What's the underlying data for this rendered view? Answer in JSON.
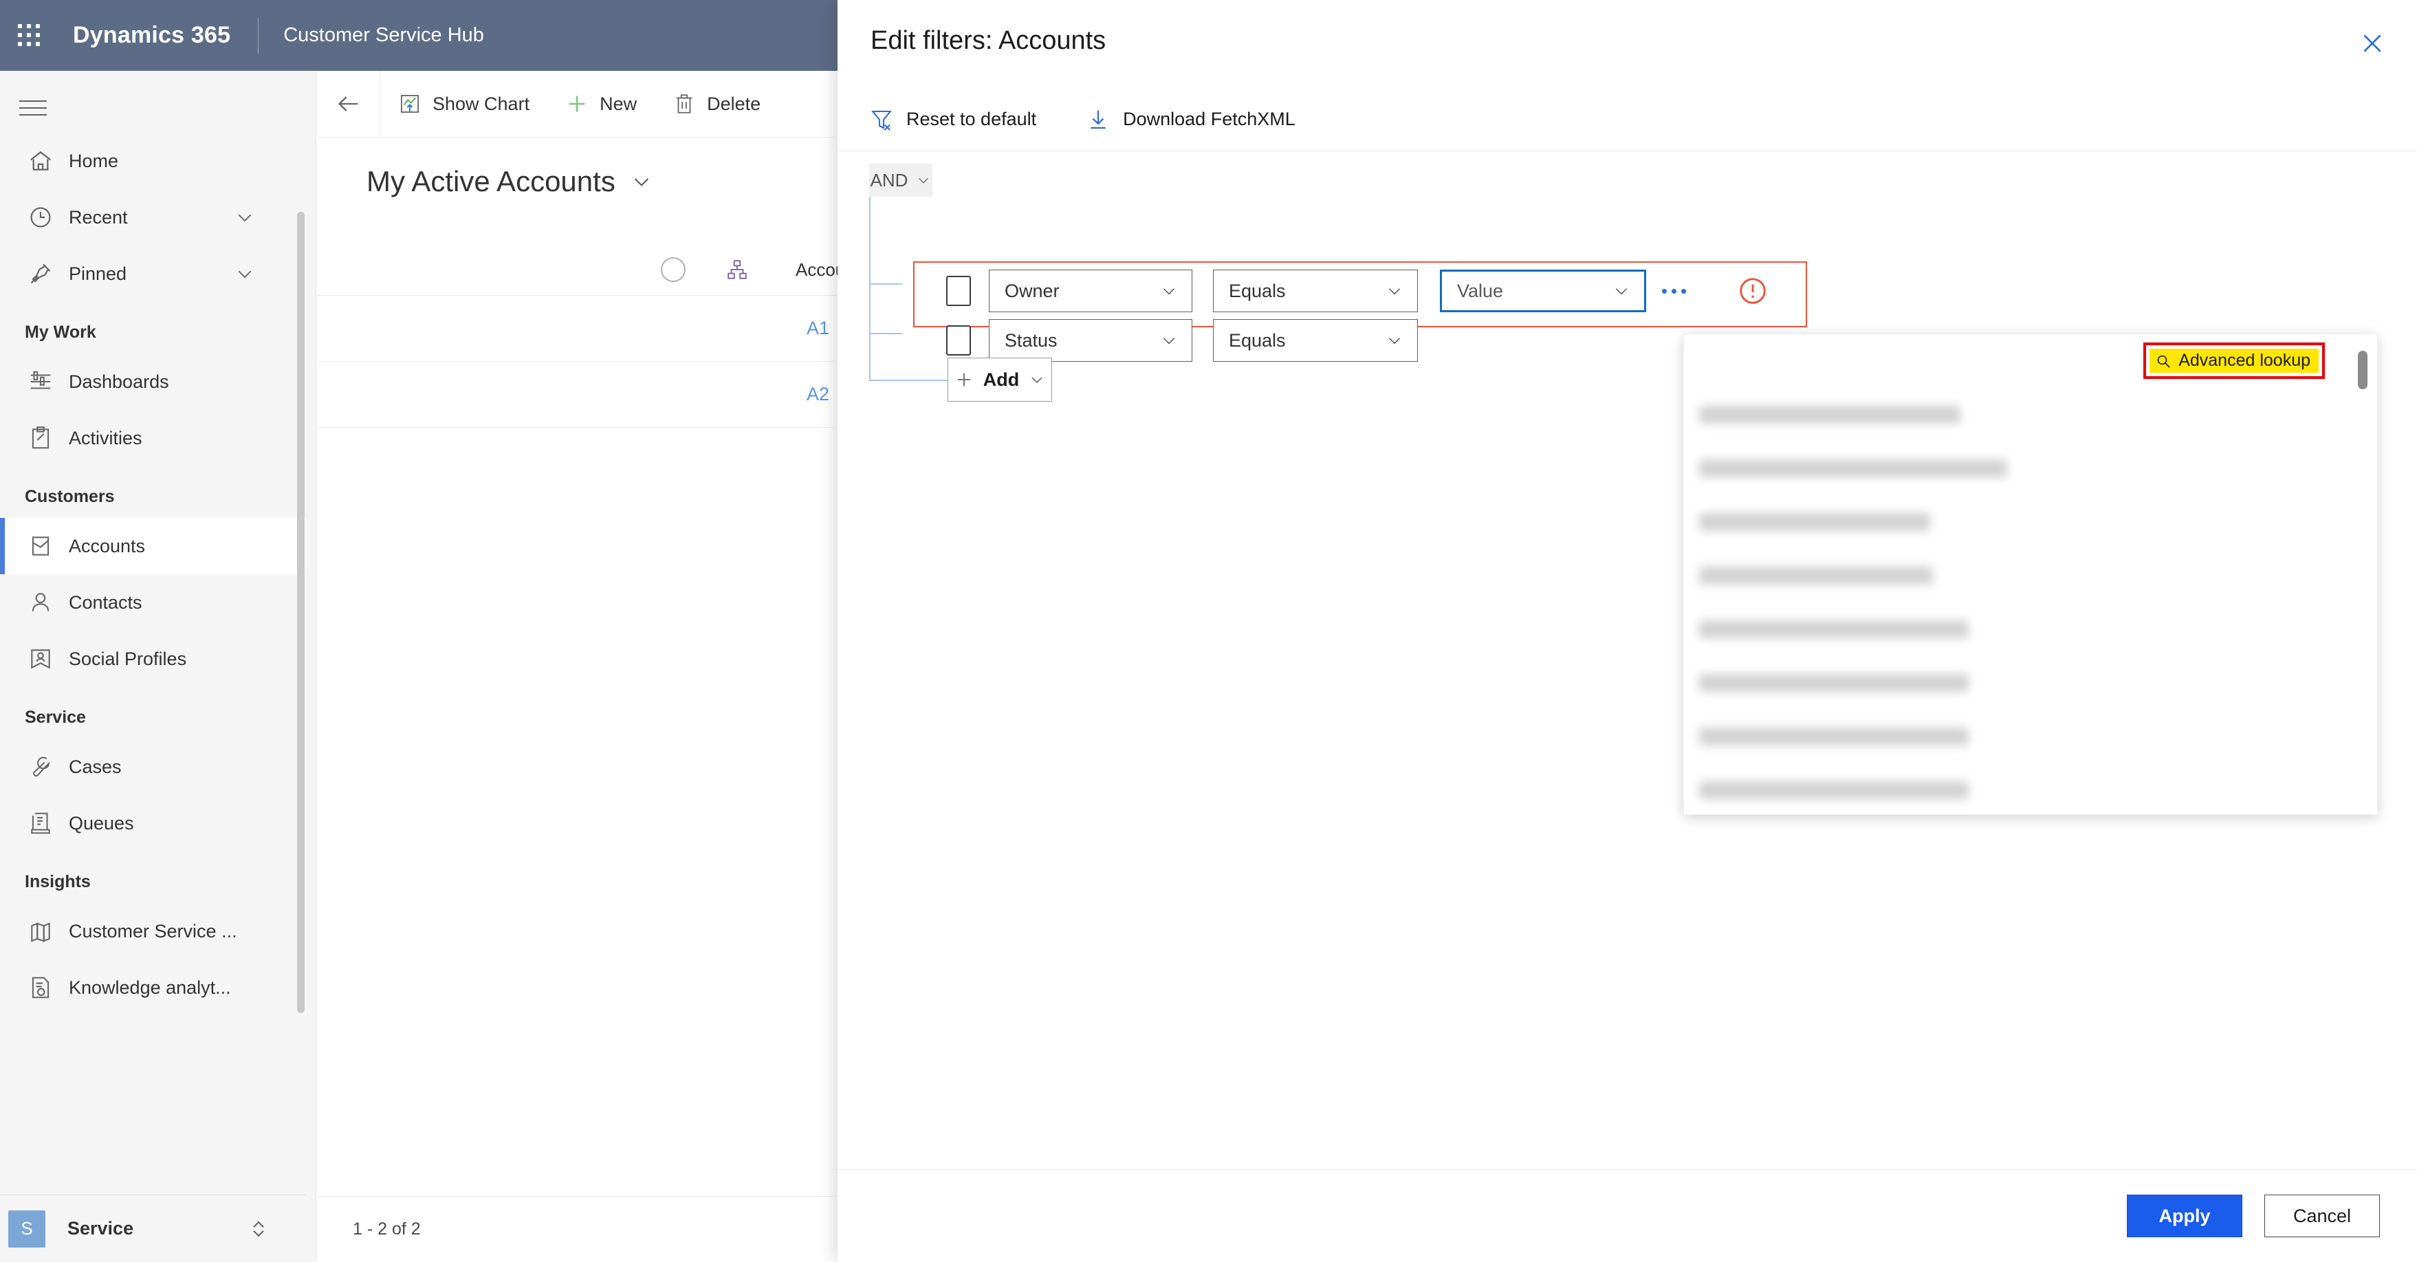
{
  "appbar": {
    "waffle_icon": "waffle-icon",
    "brand": "Dynamics 365",
    "app_name": "Customer Service Hub"
  },
  "sidebar": {
    "hamburger_icon": "hamburger-icon",
    "items": [
      {
        "label": "Home",
        "icon": "home-icon",
        "expandable": false,
        "selected": false
      },
      {
        "label": "Recent",
        "icon": "clock-icon",
        "expandable": true,
        "selected": false
      },
      {
        "label": "Pinned",
        "icon": "pin-icon",
        "expandable": true,
        "selected": false
      }
    ],
    "groups": [
      {
        "title": "My Work",
        "items": [
          {
            "label": "Dashboards",
            "icon": "dashboard-icon",
            "selected": false
          },
          {
            "label": "Activities",
            "icon": "activities-icon",
            "selected": false
          }
        ]
      },
      {
        "title": "Customers",
        "items": [
          {
            "label": "Accounts",
            "icon": "accounts-icon",
            "selected": true
          },
          {
            "label": "Contacts",
            "icon": "contact-icon",
            "selected": false
          },
          {
            "label": "Social Profiles",
            "icon": "social-profile-icon",
            "selected": false
          }
        ]
      },
      {
        "title": "Service",
        "items": [
          {
            "label": "Cases",
            "icon": "wrench-icon",
            "selected": false
          },
          {
            "label": "Queues",
            "icon": "queue-icon",
            "selected": false
          }
        ]
      },
      {
        "title": "Insights",
        "items": [
          {
            "label": "Customer Service ...",
            "icon": "bar-chart-icon",
            "selected": false
          },
          {
            "label": "Knowledge analyt...",
            "icon": "knowledge-icon",
            "selected": false
          }
        ]
      }
    ],
    "footer": {
      "initial": "S",
      "label": "Service",
      "switcher_icon": "up-down-chevron-icon"
    }
  },
  "command_bar": {
    "back_icon": "back-arrow-icon",
    "buttons": [
      {
        "label": "Show Chart",
        "icon": "show-chart-icon"
      },
      {
        "label": "New",
        "icon": "plus-icon"
      },
      {
        "label": "Delete",
        "icon": "trash-icon"
      }
    ]
  },
  "view": {
    "title": "My Active Accounts",
    "chevron_icon": "chevron-down-icon",
    "grid": {
      "select_all_icon": "select-all-circle-icon",
      "hierarchy_icon": "hierarchy-icon",
      "column_header": "Account Name",
      "sort_icon": "sort-ascending-arrow-icon",
      "header_chevron_icon": "chevron-down-icon",
      "rows": [
        {
          "account_name": "A1"
        },
        {
          "account_name": "A2"
        }
      ]
    },
    "record_count": "1 - 2 of 2"
  },
  "panel": {
    "title": "Edit filters: Accounts",
    "close_icon": "close-icon",
    "toolbar": [
      {
        "label": "Reset to default",
        "icon": "reset-filter-icon"
      },
      {
        "label": "Download FetchXML",
        "icon": "download-icon"
      }
    ],
    "group_operator": "AND",
    "group_chevron_icon": "chevron-down-icon",
    "conditions": [
      {
        "checkbox_name": "row-checkbox",
        "field": "Owner",
        "operator": "Equals",
        "value_placeholder": "Value",
        "has_error": true,
        "more_icon": "ellipsis-icon",
        "error_icon": "error-circle-icon"
      },
      {
        "checkbox_name": "row-checkbox",
        "field": "Status",
        "operator": "Equals",
        "value_placeholder": "",
        "has_error": false
      }
    ],
    "add_button": {
      "label": "Add",
      "icon": "plus-icon",
      "chevron_icon": "chevron-down-icon"
    },
    "lookup": {
      "advanced_lookup": {
        "label": "Advanced lookup",
        "icon": "search-icon",
        "highlight_color": "#ffe600",
        "annotation_color": "#e8000a"
      },
      "scrollbar_name": "lookup-scrollbar",
      "items_count": 8,
      "items_redacted": true
    },
    "footer": {
      "apply_label": "Apply",
      "cancel_label": "Cancel"
    }
  },
  "colors": {
    "appbar": "#5d6c86",
    "accent": "#1a5ceb",
    "link": "#5596e6",
    "error": "#e8553a",
    "focus_border": "#0f6cbd",
    "highlight": "#ffe600",
    "annotation": "#e8000a"
  }
}
